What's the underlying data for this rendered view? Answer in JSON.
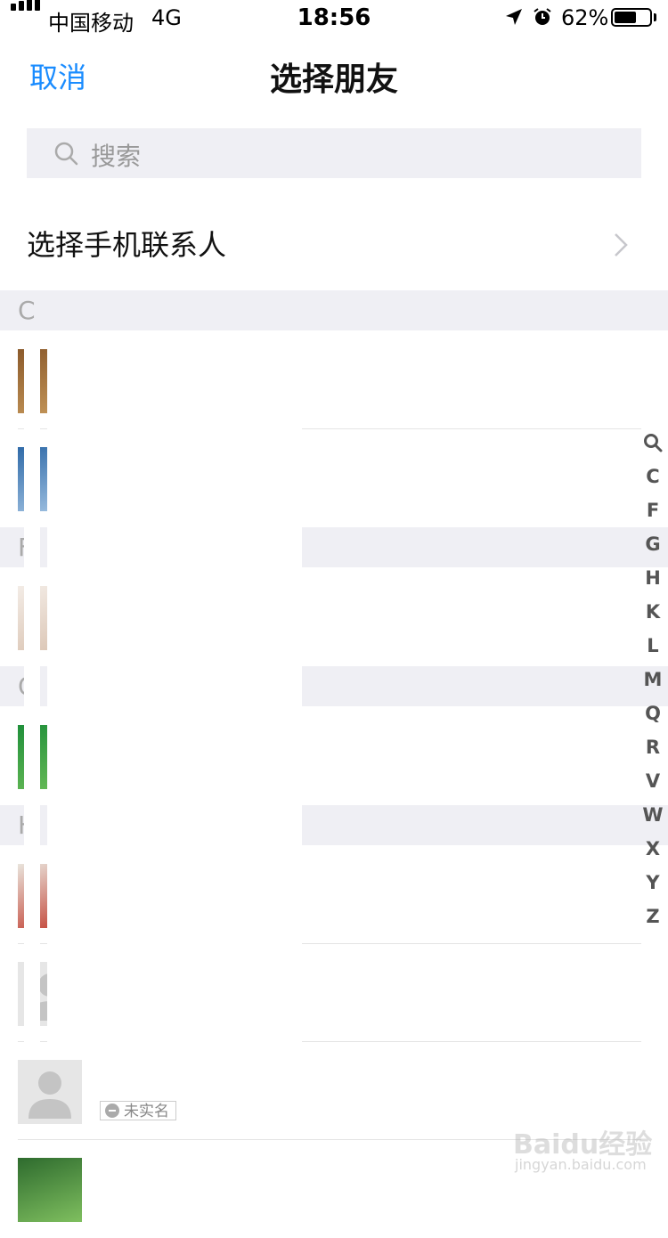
{
  "status_bar": {
    "carrier": "中国移动",
    "network": "4G",
    "time": "18:56",
    "battery_percent": "62%",
    "battery_level": 0.62,
    "icons": [
      "signal-icon",
      "location-arrow-icon",
      "alarm-clock-icon",
      "battery-icon"
    ]
  },
  "nav": {
    "cancel_label": "取消",
    "title": "选择朋友"
  },
  "search": {
    "placeholder": "搜索",
    "icon": "search-icon"
  },
  "phone_contacts": {
    "label": "选择手机联系人",
    "icon": "chevron-right-icon"
  },
  "sections": [
    {
      "letter": "C"
    },
    {
      "letter": "F"
    },
    {
      "letter": "G"
    },
    {
      "letter": "H"
    }
  ],
  "contacts": [
    {
      "avatar": "photo",
      "colors": [
        "#8b5a2b",
        "#c89a5c"
      ]
    },
    {
      "avatar": "photo",
      "colors": [
        "#2f6aa8",
        "#a9c8e6"
      ]
    },
    {
      "avatar": "photo",
      "colors": [
        "#f3ece6",
        "#d9c2b0"
      ]
    },
    {
      "avatar": "photo",
      "colors": [
        "#1f8f3a",
        "#6fbf5a"
      ]
    },
    {
      "avatar": "photo",
      "colors": [
        "#e9e4dc",
        "#c0392b"
      ]
    },
    {
      "avatar": "default"
    },
    {
      "avatar": "default",
      "badge": "未实名"
    },
    {
      "avatar": "photo",
      "colors": [
        "#2e6b2e",
        "#7fbf5f"
      ]
    }
  ],
  "index_bar": [
    "Q",
    "C",
    "F",
    "G",
    "H",
    "K",
    "L",
    "M",
    "Q",
    "R",
    "V",
    "W",
    "X",
    "Y",
    "Z"
  ],
  "watermark": {
    "main": "Baidu经验",
    "sub": "jingyan.baidu.com"
  },
  "colors": {
    "accent": "#1a8cff",
    "section_bg": "#efeff4"
  }
}
